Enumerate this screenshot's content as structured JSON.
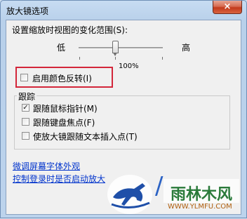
{
  "window": {
    "title": "放大镜选项",
    "close_icon": "×"
  },
  "zoom": {
    "label": "设置缩放时视图的变化范围(S):",
    "low_label": "低",
    "high_label": "高",
    "value_label": "100%"
  },
  "invert": {
    "label": "启用颜色反转(I)",
    "checked": false
  },
  "tracking": {
    "legend": "跟踪",
    "items": [
      {
        "label": "跟随鼠标指针(M)",
        "checked": true
      },
      {
        "label": "跟随键盘焦点(F)",
        "checked": false
      },
      {
        "label": "使放大镜跟随文本插入点(T)",
        "checked": false
      }
    ]
  },
  "links": {
    "font_appearance": "微调屏幕字体外观",
    "startup": "控制登录时是否启动放大"
  },
  "watermark": {
    "brand": "雨林木风",
    "url": "WWW.YLMFU.COM",
    "partial": "/"
  },
  "colors": {
    "highlight_border": "#d3263a",
    "link": "#0033cc",
    "close_button": "#c33a1c"
  }
}
